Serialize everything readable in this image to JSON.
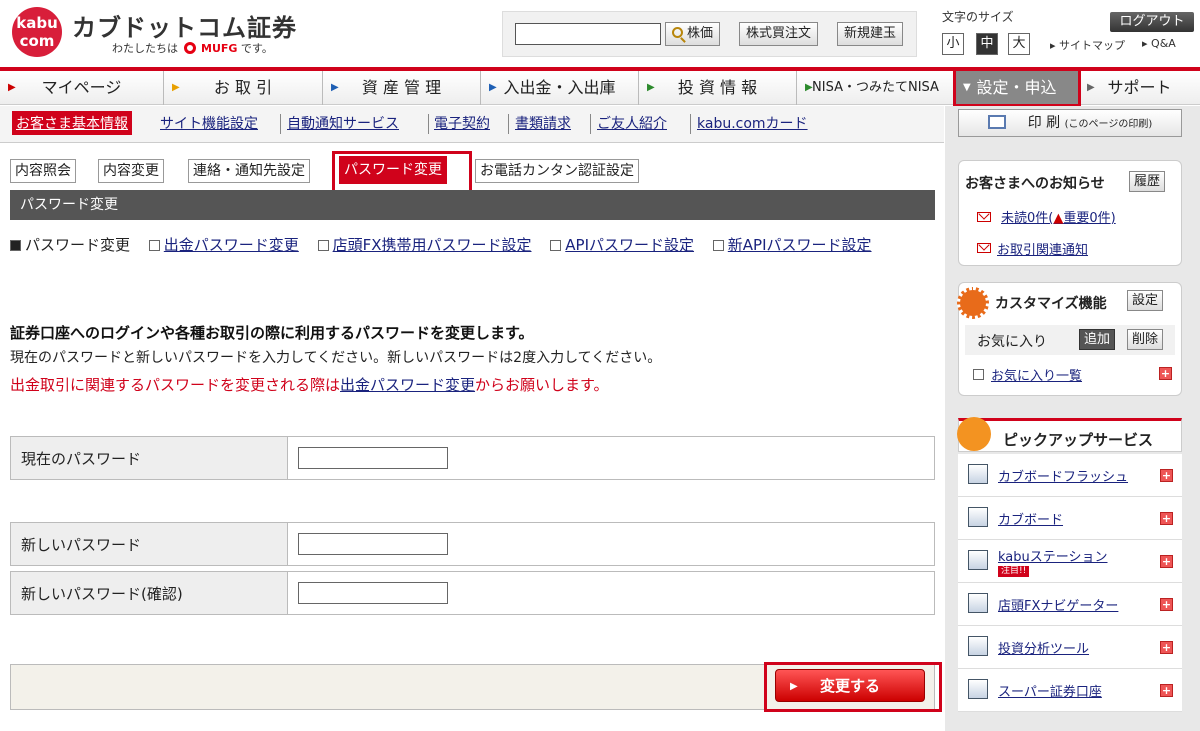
{
  "header": {
    "logo_line1": "kabu",
    "logo_line2": "com",
    "brand_name": "カブドットコム証券",
    "brand_sub_prefix": "わたしたちは",
    "brand_sub_mufg": "MUFG",
    "brand_sub_suffix": "です。",
    "search": {
      "value": "",
      "placeholder": ""
    },
    "buttons": {
      "stock_price": "株価",
      "buy_sell_order": "株式買注文",
      "new_position": "新規建玉"
    },
    "font_size_label": "文字のサイズ",
    "font_sizes": {
      "small": "小",
      "medium": "中",
      "large": "大"
    },
    "logout": "ログアウト",
    "sitemap": "サイトマップ",
    "qa": "Q&A"
  },
  "mainnav": [
    {
      "label": "マイページ"
    },
    {
      "label": "お 取 引"
    },
    {
      "label": "資 産 管 理"
    },
    {
      "label": "入出金・入出庫"
    },
    {
      "label": "投 資 情 報"
    },
    {
      "label": "NISA・つみたてNISA"
    },
    {
      "label": "設定・申込"
    },
    {
      "label": "サポート"
    }
  ],
  "subnav": [
    {
      "label": "お客さま基本情報"
    },
    {
      "label": "サイト機能設定"
    },
    {
      "label": "自動通知サービス"
    },
    {
      "label": "電子契約"
    },
    {
      "label": "書類請求"
    },
    {
      "label": "ご友人紹介"
    },
    {
      "label": "kabu.comカード"
    }
  ],
  "tabs": [
    {
      "label": "内容照会"
    },
    {
      "label": "内容変更"
    },
    {
      "label": "連絡・通知先設定"
    },
    {
      "label": "パスワード変更"
    },
    {
      "label": "お電話カンタン認証設定"
    }
  ],
  "section_title": "パスワード変更",
  "password_links": {
    "current": "パスワード変更",
    "withdrawal": "出金パスワード変更",
    "fx_mobile": "店頭FX携帯用パスワード設定",
    "api": "APIパスワード設定",
    "new_api": "新APIパスワード設定"
  },
  "description": {
    "line1": "証券口座へのログインや各種お取引の際に利用するパスワードを変更します。",
    "line2": "現在のパスワードと新しいパスワードを入力してください。新しいパスワードは2度入力してください。",
    "line3_pre": "出金取引に関連するパスワードを変更される際は",
    "line3_link": "出金パスワード変更",
    "line3_post": "からお願いします。"
  },
  "form": {
    "current_password_label": "現在のパスワード",
    "new_password_label": "新しいパスワード",
    "confirm_password_label": "新しいパスワード(確認)",
    "current_password_value": "",
    "new_password_value": "",
    "confirm_password_value": "",
    "submit": "変更する"
  },
  "sidebar": {
    "print_label": "印 刷",
    "print_note": "(このページの印刷)",
    "notice_title": "お客さまへのお知らせ",
    "history_button": "履歴",
    "unread": "未読0件(",
    "important": "重要0件",
    "unread_close": ")",
    "trade_notice": "お取引関連通知",
    "customize_title": "カスタマイズ機能",
    "settings_button": "設定",
    "favorites_label": "お気に入り",
    "add_button": "追加",
    "delete_button": "削除",
    "favorites_list": "お気に入り一覧",
    "pickup_title": "ピックアップサービス",
    "services": [
      {
        "label": "カブボードフラッシュ"
      },
      {
        "label": "カブボード"
      },
      {
        "label": "kabuステーション",
        "badge": "注目!!"
      },
      {
        "label": "店頭FXナビゲーター"
      },
      {
        "label": "投資分析ツール"
      },
      {
        "label": "スーパー証券口座"
      }
    ]
  },
  "colors": {
    "accent": "#d0021b",
    "section_bar": "#555555",
    "sidebar_bg": "#e8e8e8"
  }
}
